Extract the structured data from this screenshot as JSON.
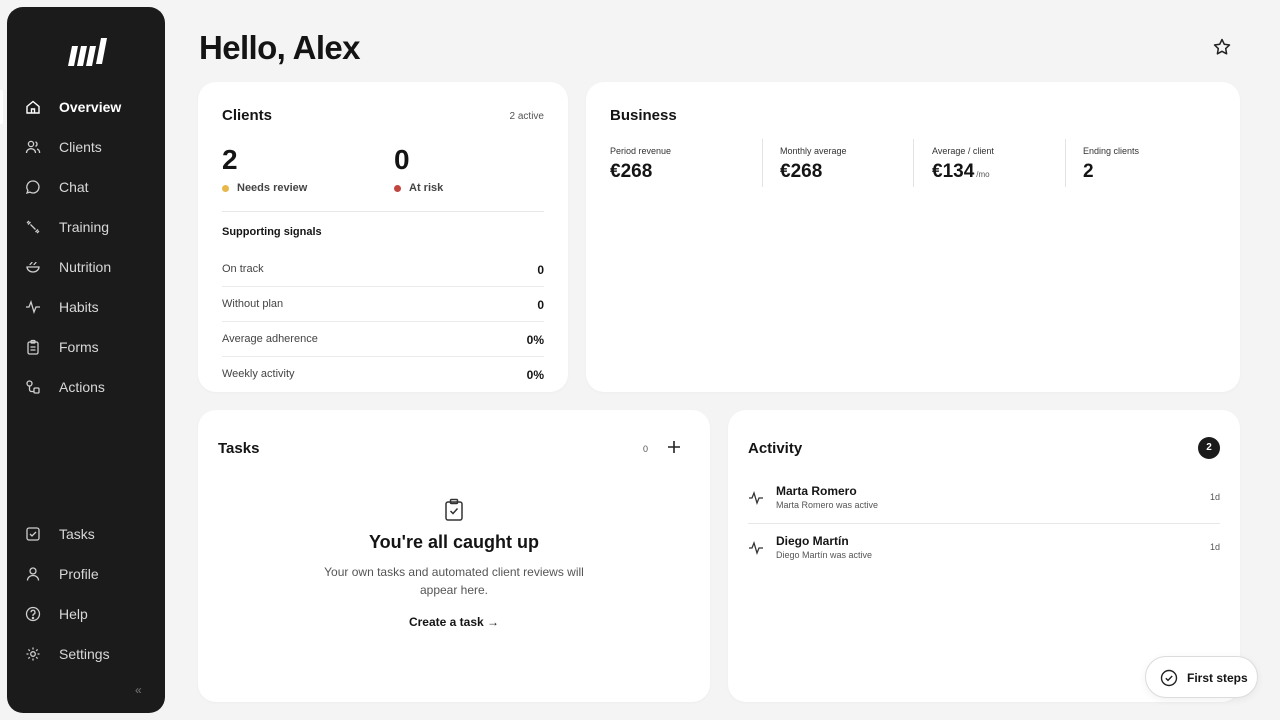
{
  "sidebar": {
    "nav": [
      {
        "label": "Overview",
        "icon": "home-icon",
        "active": true
      },
      {
        "label": "Clients",
        "icon": "users-icon"
      },
      {
        "label": "Chat",
        "icon": "chat-icon"
      },
      {
        "label": "Training",
        "icon": "dumbbell-icon"
      },
      {
        "label": "Nutrition",
        "icon": "bowl-icon"
      },
      {
        "label": "Habits",
        "icon": "pulse-icon"
      },
      {
        "label": "Forms",
        "icon": "clipboard-icon"
      },
      {
        "label": "Actions",
        "icon": "actions-icon"
      }
    ],
    "bottom": [
      {
        "label": "Tasks",
        "icon": "checkbox-icon"
      },
      {
        "label": "Profile",
        "icon": "user-icon"
      },
      {
        "label": "Help",
        "icon": "help-icon"
      },
      {
        "label": "Settings",
        "icon": "gear-icon"
      }
    ],
    "collapse_glyph": "«"
  },
  "header": {
    "greeting": "Hello, Alex"
  },
  "clients": {
    "title": "Clients",
    "active_count": "2 active",
    "needs_review": {
      "value": "2",
      "label": "Needs review"
    },
    "at_risk": {
      "value": "0",
      "label": "At risk"
    },
    "signals_title": "Supporting signals",
    "signals": [
      {
        "label": "On track",
        "value": "0"
      },
      {
        "label": "Without plan",
        "value": "0"
      },
      {
        "label": "Average adherence",
        "value": "0%"
      },
      {
        "label": "Weekly activity",
        "value": "0%"
      }
    ]
  },
  "business": {
    "title": "Business",
    "metrics": [
      {
        "label": "Period revenue",
        "value": "€268",
        "unit": ""
      },
      {
        "label": "Monthly average",
        "value": "€268",
        "unit": ""
      },
      {
        "label": "Average / client",
        "value": "€134",
        "unit": "/mo"
      },
      {
        "label": "Ending clients",
        "value": "2",
        "unit": ""
      }
    ]
  },
  "tasks": {
    "title": "Tasks",
    "count": "0",
    "empty_title": "You're all caught up",
    "empty_text": "Your own tasks and automated client reviews will appear here.",
    "create_label": "Create a task →"
  },
  "activity": {
    "title": "Activity",
    "badge": "2",
    "items": [
      {
        "name": "Marta Romero",
        "desc": "Marta Romero was active",
        "time": "1d"
      },
      {
        "name": "Diego Martín",
        "desc": "Diego Martín was active",
        "time": "1d"
      }
    ]
  },
  "first_steps": {
    "label": "First steps"
  },
  "colors": {
    "sidebar": "#1b1b1b",
    "needs_review": "#e8b84a",
    "at_risk": "#c0463f",
    "background": "#f4f4f4"
  }
}
